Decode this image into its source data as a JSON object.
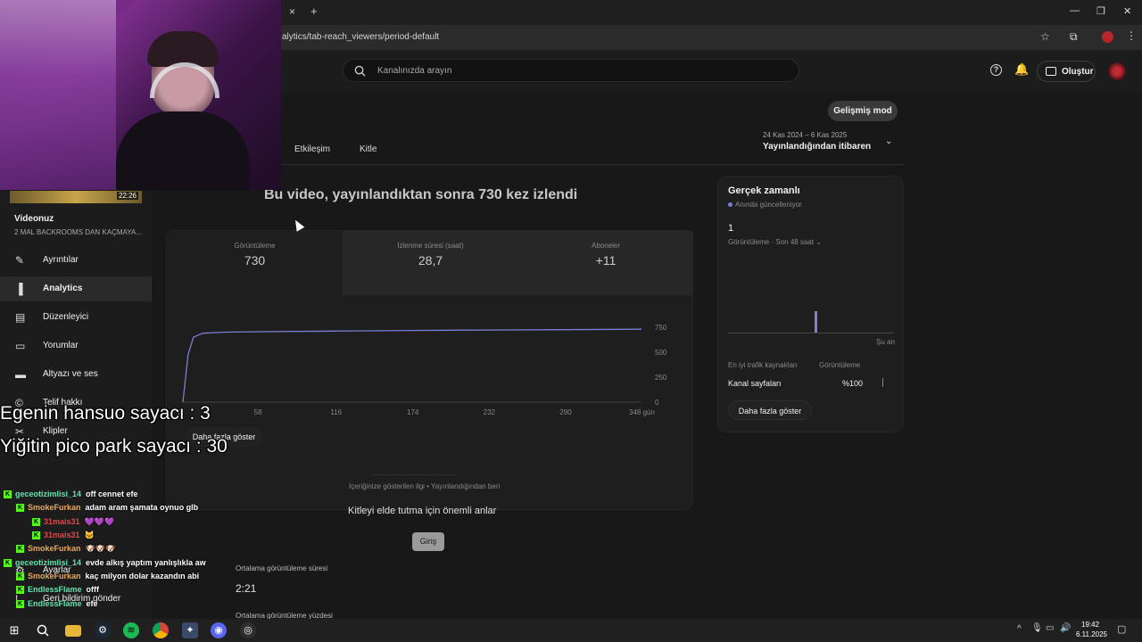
{
  "browser": {
    "url": "alytics/tab-reach_viewers/period-default",
    "new_tab": "+",
    "close_tab": "×"
  },
  "topbar": {
    "search_placeholder": "Kanalınızda arayın",
    "create_label": "Oluştur"
  },
  "advanced_mode": "Gelişmiş mod",
  "tabs": [
    "Etkileşim",
    "Kitle"
  ],
  "date_range": {
    "dates": "24 Kas 2024 – 6 Kas 2025",
    "label": "Yayınlandığından itibaren"
  },
  "sidebar": {
    "video_heading": "Videonuz",
    "video_title": "2 MAL BACKROOMS DAN KAÇMAYA...",
    "timestamp": "22:26",
    "items": [
      {
        "label": "Ayrıntılar",
        "icon": "pencil-icon"
      },
      {
        "label": "Analytics",
        "icon": "analytics-icon"
      },
      {
        "label": "Düzenleyici",
        "icon": "editor-icon"
      },
      {
        "label": "Yorumlar",
        "icon": "comments-icon"
      },
      {
        "label": "Altyazı ve ses",
        "icon": "subtitles-icon"
      },
      {
        "label": "Telif hakkı",
        "icon": "copyright-icon"
      },
      {
        "label": "Klipler",
        "icon": "clips-icon"
      },
      {
        "label": "Ayarlar",
        "icon": "settings-icon"
      },
      {
        "label": "Geri bildirim gönder",
        "icon": "feedback-icon"
      }
    ]
  },
  "main": {
    "headline": "Bu video, yayınlandıktan sonra 730 kez izlendi",
    "metrics": [
      {
        "label": "Görüntüleme",
        "value": "730"
      },
      {
        "label": "İzlenme süresi (saat)",
        "value": "28,7"
      },
      {
        "label": "Aboneler",
        "value": "+11"
      }
    ],
    "show_more": "Daha fazla göster",
    "insight_caption": "İçeriğinize gösterilen ilgi • Yayınlandığından beri",
    "key_moments_title": "Kitleyi elde tutma için önemli anlar",
    "intro_button": "Giriş",
    "avg_view_duration_label": "Ortalama görüntüleme süresi",
    "avg_view_duration_value": "2:21",
    "avg_view_percent_label": "Ortalama görüntüleme yüzdesi"
  },
  "chart_data": {
    "type": "line",
    "x": [
      0,
      4,
      8,
      15,
      30,
      58,
      116,
      174,
      232,
      290,
      348
    ],
    "x_ticks": [
      "0",
      "58",
      "116",
      "174",
      "232",
      "290",
      "348 gün"
    ],
    "y_ticks": [
      "750",
      "500",
      "250",
      "0"
    ],
    "ylim": [
      0,
      750
    ],
    "series": [
      {
        "values": [
          0,
          480,
          650,
          690,
          700,
          705,
          712,
          718,
          722,
          726,
          730
        ]
      }
    ],
    "line_color": "#7b7fd6"
  },
  "realtime": {
    "title": "Gerçek zamanlı",
    "subtitle": "Anında güncelleniyor",
    "count": "1",
    "views_label": "Görüntüleme · Son 48 saat",
    "now_label": "Şu an",
    "traffic_header": "En iyi trafik kaynakları",
    "views_header": "Görüntüleme",
    "source_name": "Kanal sayfaları",
    "source_value": "%100",
    "show_more": "Daha fazla göster",
    "spark_value_fraction": 0.6
  },
  "overlay": {
    "counter1": "Egenin hansuo sayacı : 3",
    "counter2": "Yiğitin pico park sayacı : 30",
    "chat": [
      {
        "user": "geceotizimlisi_14",
        "msg": "off cennet efe",
        "color": "#5ee3b0"
      },
      {
        "user": "SmokeFurkan",
        "msg": "adam aram şamata oynuo glb",
        "color": "#e8a85a"
      },
      {
        "user": "31mais31",
        "msg": "💜💜💜",
        "color": "#e04848"
      },
      {
        "user": "31mais31",
        "msg": "🐱",
        "color": "#e04848"
      },
      {
        "user": "SmokeFurkan",
        "msg": "🐶🐶🐶",
        "color": "#e8a85a"
      },
      {
        "user": "geceotizimlisi_14",
        "msg": "evde alkış yaptım yanlışlıkla aw",
        "color": "#5ee3b0"
      },
      {
        "user": "SmokeFurkan",
        "msg": "kaç milyon dolar kazandın abi",
        "color": "#e8a85a"
      },
      {
        "user": "EndlessFlame",
        "msg": "offf",
        "color": "#5ee3b0"
      },
      {
        "user": "EndlessFlame",
        "msg": "efe",
        "color": "#5ee3b0"
      }
    ]
  },
  "taskbar": {
    "time": "19:42",
    "date": "6.11.2025"
  }
}
